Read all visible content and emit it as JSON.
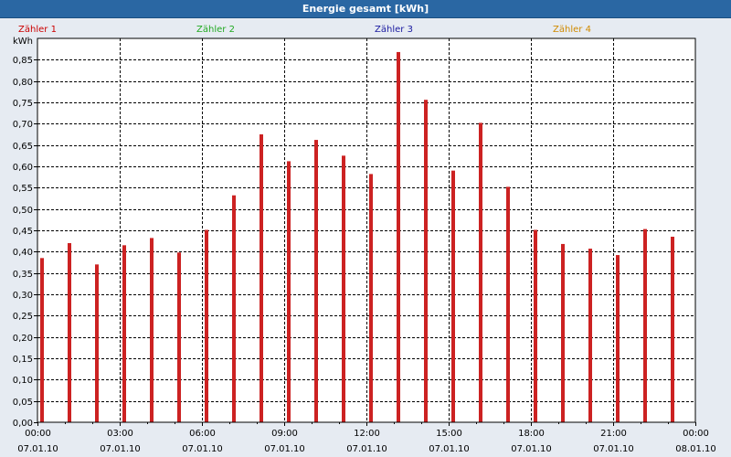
{
  "window": {
    "title": "Energie gesamt [kWh]"
  },
  "colors": {
    "titlebar": "#2a67a3",
    "background": "#e6ebf2",
    "bar": "#cc2222",
    "grid": "#000000"
  },
  "chart_data": {
    "type": "bar",
    "title": "Energie gesamt [kWh]",
    "ylabel": "kWh",
    "xlabel": "",
    "ylim": [
      0,
      0.9
    ],
    "yticks": [
      "0,00",
      "0,05",
      "0,10",
      "0,15",
      "0,20",
      "0,25",
      "0,30",
      "0,35",
      "0,40",
      "0,45",
      "0,50",
      "0,55",
      "0,60",
      "0,65",
      "0,70",
      "0,75",
      "0,80",
      "0,85"
    ],
    "grid": true,
    "legend_position": "top",
    "series": [
      {
        "name": "Zähler 1",
        "color": "#cc0000"
      },
      {
        "name": "Zähler 2",
        "color": "#22aa22"
      },
      {
        "name": "Zähler 3",
        "color": "#1a1aa0"
      },
      {
        "name": "Zähler 4",
        "color": "#d08a00"
      }
    ],
    "xticks": [
      {
        "time": "00:00",
        "date": "07.01.10"
      },
      {
        "time": "03:00",
        "date": "07.01.10"
      },
      {
        "time": "06:00",
        "date": "07.01.10"
      },
      {
        "time": "09:00",
        "date": "07.01.10"
      },
      {
        "time": "12:00",
        "date": "07.01.10"
      },
      {
        "time": "15:00",
        "date": "07.01.10"
      },
      {
        "time": "18:00",
        "date": "07.01.10"
      },
      {
        "time": "21:00",
        "date": "07.01.10"
      },
      {
        "time": "00:00",
        "date": "08.01.10"
      }
    ],
    "categories": [
      "00:00",
      "01:00",
      "02:00",
      "03:00",
      "04:00",
      "05:00",
      "06:00",
      "07:00",
      "08:00",
      "09:00",
      "10:00",
      "11:00",
      "12:00",
      "13:00",
      "14:00",
      "15:00",
      "16:00",
      "17:00",
      "18:00",
      "19:00",
      "20:00",
      "21:00",
      "22:00",
      "23:00"
    ],
    "values": [
      0.385,
      0.42,
      0.37,
      0.415,
      0.432,
      0.398,
      0.451,
      0.532,
      0.675,
      0.612,
      0.662,
      0.625,
      0.582,
      0.868,
      0.756,
      0.59,
      0.702,
      0.552,
      0.451,
      0.418,
      0.407,
      0.392,
      0.453,
      0.435
    ]
  }
}
